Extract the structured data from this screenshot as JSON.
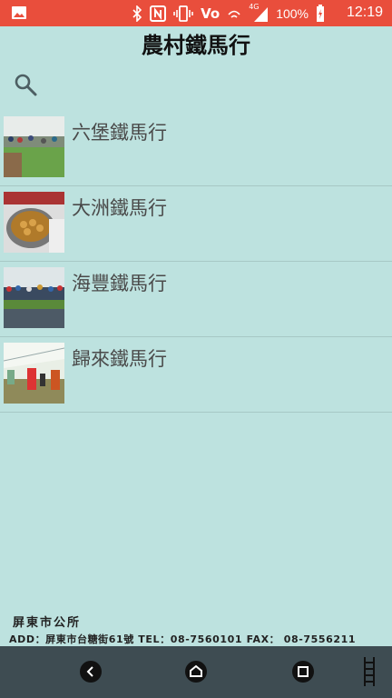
{
  "status_bar": {
    "battery_percent": "100%",
    "time": "12:19",
    "network_label": "4G",
    "volte_label": "Vo"
  },
  "header": {
    "title": "農村鐵馬行"
  },
  "list": {
    "items": [
      {
        "label": "六堡鐵馬行"
      },
      {
        "label": "大洲鐵馬行"
      },
      {
        "label": "海豐鐵馬行"
      },
      {
        "label": "歸來鐵馬行"
      }
    ]
  },
  "footer": {
    "org_name": "屏東市公所",
    "address_line": "ADD：屏東市台糖街61號 TEL：08-7560101 FAX： 08-7556211"
  },
  "colors": {
    "background": "#bde2df",
    "status_bar": "#e94e3c",
    "nav_bar": "#3e4c52"
  }
}
